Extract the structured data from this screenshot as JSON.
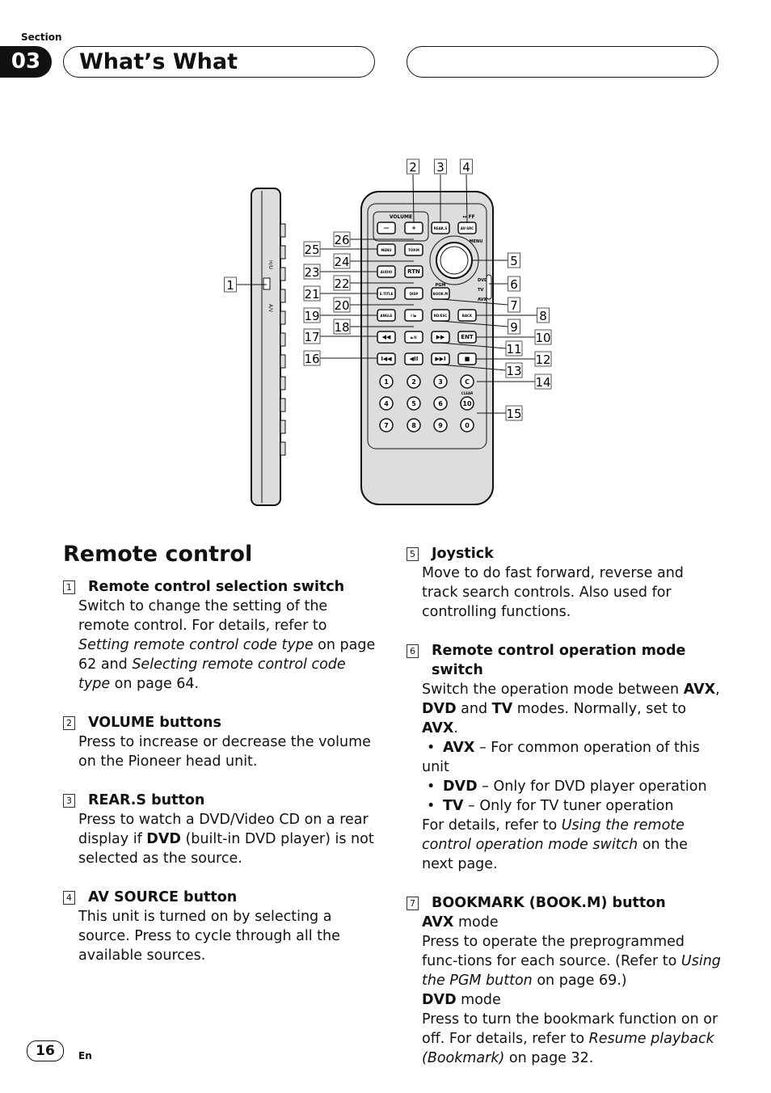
{
  "header": {
    "section_label": "Section",
    "section_number": "03",
    "title": "What’s What"
  },
  "diagram": {
    "volume_label": "VOLUME",
    "ff_label": "↔ FF",
    "amenu_label": "A.MENU",
    "pgm_label": "PGM",
    "clear_label": "CLEAR",
    "mode_labels": [
      "DVD",
      "TV",
      "AVX"
    ],
    "side_labels": [
      "H/U",
      "A/V"
    ],
    "buttons": [
      "—",
      "+",
      "REAR.S",
      "AV-SRC",
      "MENU",
      "TOP.M",
      "AUDIO",
      "RTN",
      "S.TITLE",
      "DISP",
      "BOOK.M",
      "ANGLE",
      "I I▶",
      "RD/ESC",
      "BACK",
      "◀◀",
      "▶/II",
      "▶▶",
      "ENT",
      "I◀◀",
      "◀II",
      "▶▶I",
      "■"
    ],
    "number_keys": [
      "1",
      "2",
      "3",
      "C",
      "4",
      "5",
      "6",
      "10",
      "7",
      "8",
      "9",
      "0"
    ],
    "callouts": [
      "1",
      "2",
      "3",
      "4",
      "5",
      "6",
      "7",
      "8",
      "9",
      "10",
      "11",
      "12",
      "13",
      "14",
      "15",
      "16",
      "17",
      "18",
      "19",
      "20",
      "21",
      "22",
      "23",
      "24",
      "25",
      "26"
    ]
  },
  "heading": "Remote control",
  "left_items": [
    {
      "num": "1",
      "title": "Remote control selection switch",
      "body": [
        [
          {
            "t": "Switch to change the setting of the remote control. For details, refer to "
          },
          {
            "t": "Setting remote control code type",
            "s": "i"
          },
          {
            "t": " on page 62 and "
          },
          {
            "t": "Selecting remote control code type",
            "s": "i"
          },
          {
            "t": " on page 64."
          }
        ]
      ]
    },
    {
      "num": "2",
      "title": "VOLUME buttons",
      "body": [
        [
          {
            "t": "Press to increase or decrease the volume on the Pioneer head unit."
          }
        ]
      ]
    },
    {
      "num": "3",
      "title": "REAR.S button",
      "body": [
        [
          {
            "t": "Press to watch a DVD/Video CD on a rear display if "
          },
          {
            "t": "DVD",
            "s": "b"
          },
          {
            "t": " (built-in DVD player) is not selected as the source."
          }
        ]
      ]
    },
    {
      "num": "4",
      "title": "AV SOURCE button",
      "body": [
        [
          {
            "t": "This unit is turned on by selecting a source. Press to cycle through all the available sources."
          }
        ]
      ]
    }
  ],
  "right_items": [
    {
      "num": "5",
      "title": "Joystick",
      "body": [
        [
          {
            "t": "Move to do fast forward, reverse and track search controls. Also used for controlling functions."
          }
        ]
      ]
    },
    {
      "num": "6",
      "title": "Remote control operation mode switch",
      "body": [
        [
          {
            "t": "Switch the operation mode between "
          },
          {
            "t": "AVX",
            "s": "b"
          },
          {
            "t": ", "
          },
          {
            "t": "DVD",
            "s": "b"
          },
          {
            "t": " and "
          },
          {
            "t": "TV",
            "s": "b"
          },
          {
            "t": " modes. Normally, set to "
          },
          {
            "t": "AVX",
            "s": "b"
          },
          {
            "t": "."
          }
        ],
        [
          {
            "t": "•",
            "s": "bul"
          },
          {
            "t": "AVX",
            "s": "b"
          },
          {
            "t": " – For common operation of this unit"
          }
        ],
        [
          {
            "t": "•",
            "s": "bul"
          },
          {
            "t": "DVD",
            "s": "b"
          },
          {
            "t": " – Only for DVD player operation"
          }
        ],
        [
          {
            "t": "•",
            "s": "bul"
          },
          {
            "t": "TV",
            "s": "b"
          },
          {
            "t": " – Only for TV tuner operation"
          }
        ],
        [
          {
            "t": "For details, refer to "
          },
          {
            "t": "Using the remote control operation mode switch",
            "s": "i"
          },
          {
            "t": " on the next page."
          }
        ]
      ]
    },
    {
      "num": "7",
      "title": "BOOKMARK (BOOK.M) button",
      "body": [
        [
          {
            "t": "AVX",
            "s": "b"
          },
          {
            "t": " mode"
          }
        ],
        [
          {
            "t": "Press to operate the preprogrammed func-tions for each source. (Refer to "
          },
          {
            "t": "Using the PGM button",
            "s": "i"
          },
          {
            "t": " on page 69.)"
          }
        ],
        [
          {
            "t": "DVD",
            "s": "b"
          },
          {
            "t": " mode"
          }
        ],
        [
          {
            "t": "Press to turn the bookmark function on or off. For details, refer to "
          },
          {
            "t": "Resume playback (Bookmark)",
            "s": "i"
          },
          {
            "t": " on page 32."
          }
        ]
      ]
    }
  ],
  "footer": {
    "page_number": "16",
    "language": "En"
  }
}
